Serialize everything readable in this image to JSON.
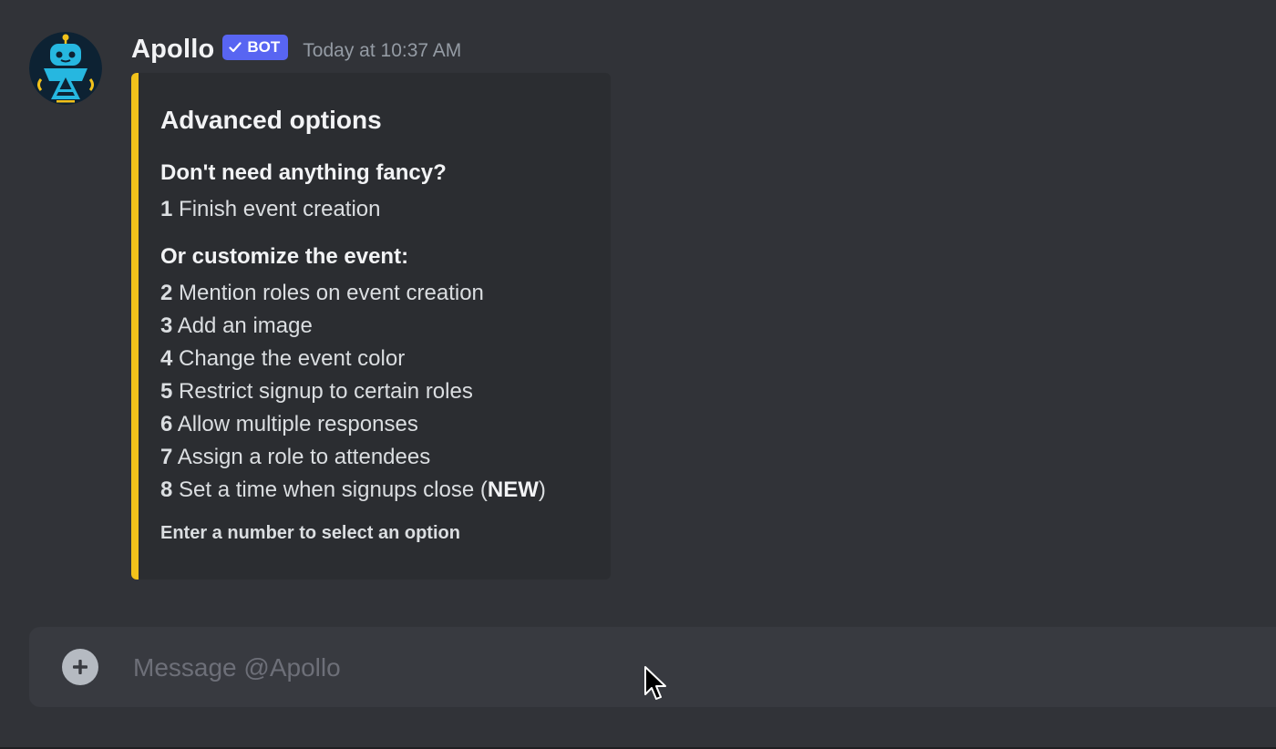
{
  "message": {
    "author": "Apollo",
    "bot_tag": "BOT",
    "timestamp": "Today at 10:37 AM",
    "avatar_icon": "robot-avatar-icon"
  },
  "embed": {
    "accent_color": "#f2c21b",
    "title": "Advanced options",
    "basic_heading": "Don't need anything fancy?",
    "basic_options": [
      {
        "number": "1",
        "label": "Finish event creation"
      }
    ],
    "custom_heading": "Or customize the event:",
    "custom_options": [
      {
        "number": "2",
        "label": "Mention roles on event creation"
      },
      {
        "number": "3",
        "label": "Add an image"
      },
      {
        "number": "4",
        "label": "Change the event color"
      },
      {
        "number": "5",
        "label": "Restrict signup to certain roles"
      },
      {
        "number": "6",
        "label": "Allow multiple responses"
      },
      {
        "number": "7",
        "label": "Assign a role to attendees"
      },
      {
        "number": "8",
        "label": "Set a time when signups close (",
        "badge": "NEW",
        "suffix": ")"
      }
    ],
    "footer": "Enter a number to select an option"
  },
  "composer": {
    "placeholder": "Message @Apollo",
    "value": "",
    "add_icon": "plus-circle-icon"
  },
  "colors": {
    "background": "#313338",
    "embed_background": "#2b2d31",
    "bot_tag": "#5865f2",
    "composer": "#383a40"
  }
}
